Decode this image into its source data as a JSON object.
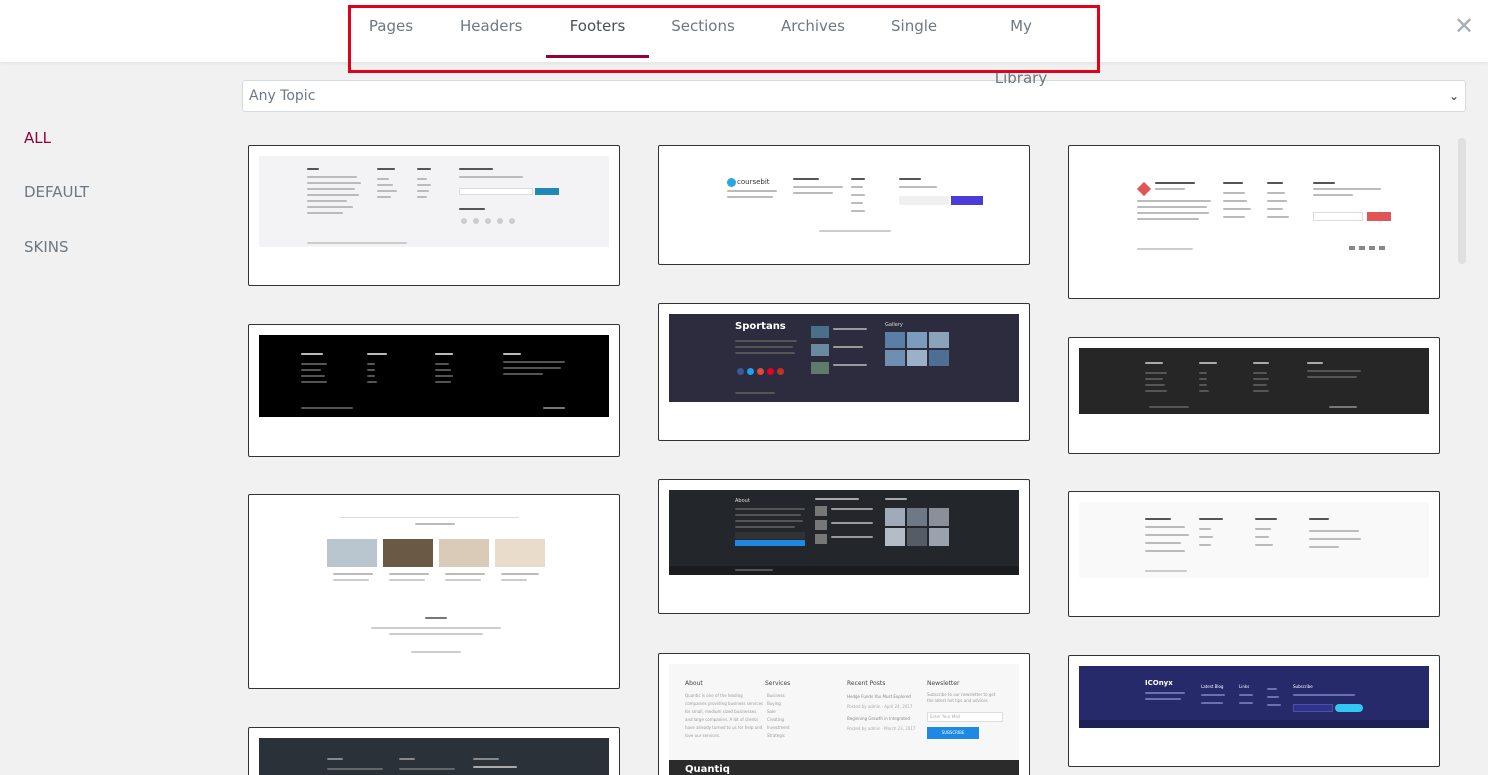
{
  "tabs": [
    "Pages",
    "Headers",
    "Footers",
    "Sections",
    "Archives",
    "Single",
    "My Library"
  ],
  "active_tab": "Footers",
  "close_glyph": "✕",
  "sidebar": {
    "items": [
      "ALL",
      "DEFAULT",
      "SKINS"
    ],
    "active": "ALL"
  },
  "filter": {
    "value": "Any Topic"
  },
  "colors": {
    "accent": "#93003c",
    "highlight": "#e2001a"
  },
  "thumbs": {
    "sportans_logo": "Sportans",
    "sportans_gallery": "Gallery",
    "about": "About",
    "services": "Services",
    "recent_posts": "Recent Posts",
    "newsletter": "Newsletter",
    "about_text": "Quantic is one of the leading companies providing business services for small, medium sized businesses and large companies. A lot of clients have already turned to us for help and love our services.",
    "services_list": [
      "Business",
      "Buying",
      "Sale",
      "Creating",
      "Investment",
      "Strategic"
    ],
    "post1": "Hedge Funds You Must Explored",
    "post1_meta": "Posted by admin · April 24, 2017",
    "post2": "Beginning Growth in Integrated",
    "post2_meta": "Posted by admin · March 23, 2017",
    "newsletter_text": "Subscribe to our newsletter to get the latest hot tips and advices",
    "newsletter_placeholder": "Enter Your Mail",
    "subscribe_btn": "SUBSCRIBE",
    "quantic_logo": "Quantiq",
    "iconyx_logo": "ICOnyx",
    "iconyx_cols": [
      "Latest Blog",
      "Links",
      "Subscribe"
    ],
    "coursebit_logo": "coursebit"
  }
}
